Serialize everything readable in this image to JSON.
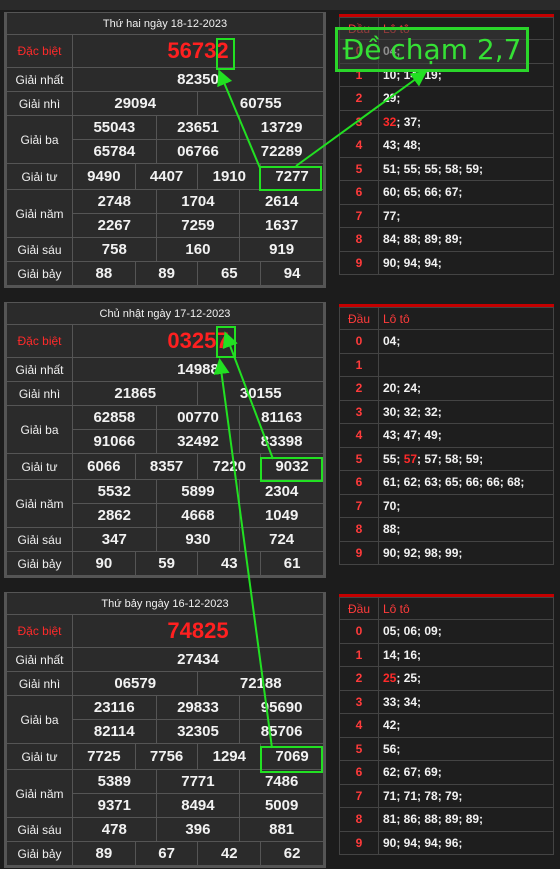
{
  "labels": {
    "db": "Đặc biệt",
    "g1": "Giải nhất",
    "g2": "Giải nhì",
    "g3": "Giải ba",
    "g4": "Giải tư",
    "g5": "Giải năm",
    "g6": "Giải sáu",
    "g7": "Giải bảy",
    "dau": "Đầu",
    "loto": "Lô tô"
  },
  "annotation": "Đề chạm 2,7",
  "draws": [
    {
      "date": "Thứ hai ngày 18-12-2023",
      "db": "56732",
      "g1": "82350",
      "g2": [
        "29094",
        "60755"
      ],
      "g3a": [
        "55043",
        "23651",
        "13729"
      ],
      "g3b": [
        "65784",
        "06766",
        "72289"
      ],
      "g4": [
        "9490",
        "4407",
        "1910",
        "7277"
      ],
      "g5a": [
        "2748",
        "1704",
        "2614"
      ],
      "g5b": [
        "2267",
        "7259",
        "1637"
      ],
      "g6": [
        "758",
        "160",
        "919"
      ],
      "g7": [
        "88",
        "89",
        "65",
        "94"
      ],
      "loto": [
        [
          "0",
          "04;"
        ],
        [
          "1",
          "10; 14; 19;"
        ],
        [
          "2",
          "29;"
        ],
        [
          "3",
          "32; 37;"
        ],
        [
          "4",
          "43; 48;"
        ],
        [
          "5",
          "51; 55; 55; 58; 59;"
        ],
        [
          "6",
          "60; 65; 66; 67;"
        ],
        [
          "7",
          "77;"
        ],
        [
          "8",
          "84; 88; 89; 89;"
        ],
        [
          "9",
          "90; 94; 94;"
        ]
      ]
    },
    {
      "date": "Chủ nhật ngày 17-12-2023",
      "db": "03257",
      "g1": "14988",
      "g2": [
        "21865",
        "30155"
      ],
      "g3a": [
        "62858",
        "00770",
        "81163"
      ],
      "g3b": [
        "91066",
        "32492",
        "83398"
      ],
      "g4": [
        "6066",
        "8357",
        "7220",
        "9032"
      ],
      "g5a": [
        "5532",
        "5899",
        "2304"
      ],
      "g5b": [
        "2862",
        "4668",
        "1049"
      ],
      "g6": [
        "347",
        "930",
        "724"
      ],
      "g7": [
        "90",
        "59",
        "43",
        "61"
      ],
      "loto": [
        [
          "0",
          "04;"
        ],
        [
          "1",
          ""
        ],
        [
          "2",
          "20; 24;"
        ],
        [
          "3",
          "30; 32; 32;"
        ],
        [
          "4",
          "43; 47; 49;"
        ],
        [
          "5",
          "55; 57; 57; 58; 59;"
        ],
        [
          "6",
          "61; 62; 63; 65; 66; 66; 68;"
        ],
        [
          "7",
          "70;"
        ],
        [
          "8",
          "88;"
        ],
        [
          "9",
          "90; 92; 98; 99;"
        ]
      ]
    },
    {
      "date": "Thứ bảy ngày 16-12-2023",
      "db": "74825",
      "g1": "27434",
      "g2": [
        "06579",
        "72188"
      ],
      "g3a": [
        "23116",
        "29833",
        "95690"
      ],
      "g3b": [
        "82114",
        "32305",
        "85706"
      ],
      "g4": [
        "7725",
        "7756",
        "1294",
        "7069"
      ],
      "g5a": [
        "5389",
        "7771",
        "7486"
      ],
      "g5b": [
        "9371",
        "8494",
        "5009"
      ],
      "g6": [
        "478",
        "396",
        "881"
      ],
      "g7": [
        "89",
        "67",
        "42",
        "62"
      ],
      "loto": [
        [
          "0",
          "05; 06; 09;"
        ],
        [
          "1",
          "14; 16;"
        ],
        [
          "2",
          "25; 25;"
        ],
        [
          "3",
          "33; 34;"
        ],
        [
          "4",
          "42;"
        ],
        [
          "5",
          "56;"
        ],
        [
          "6",
          "62; 67; 69;"
        ],
        [
          "7",
          "71; 71; 78; 79;"
        ],
        [
          "8",
          "81; 86; 88; 89; 89;"
        ],
        [
          "9",
          "90; 94; 94; 96;"
        ]
      ]
    }
  ]
}
